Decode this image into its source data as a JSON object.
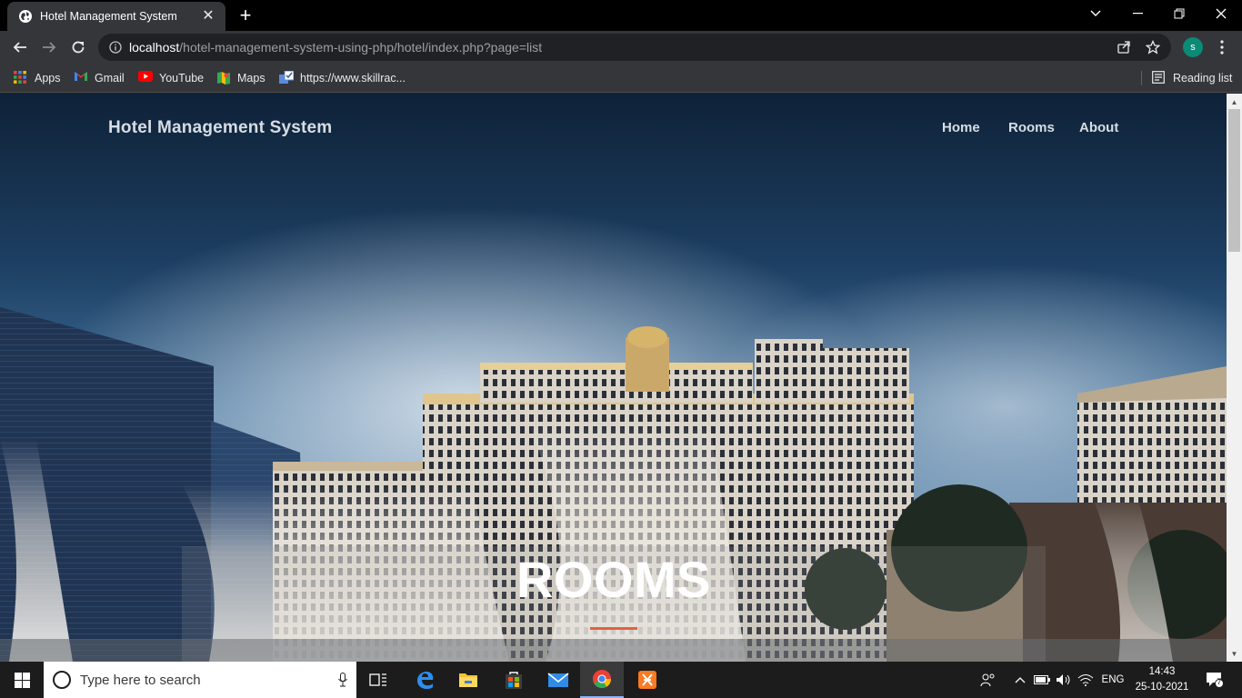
{
  "browser": {
    "tab_title": "Hotel Management System",
    "url_host": "localhost",
    "url_path": "/hotel-management-system-using-php/hotel/index.php?page=list",
    "profile_initial": "s",
    "profile_color": "#0b8a76"
  },
  "bookmarks": {
    "items": [
      {
        "label": "Apps",
        "icon": "apps-grid-icon"
      },
      {
        "label": "Gmail",
        "icon": "gmail-icon"
      },
      {
        "label": "YouTube",
        "icon": "youtube-icon"
      },
      {
        "label": "Maps",
        "icon": "maps-icon"
      },
      {
        "label": "https://www.skillrac...",
        "icon": "skillrack-icon"
      }
    ],
    "reading_list": "Reading list"
  },
  "site": {
    "brand": "Hotel Management System",
    "nav": [
      {
        "label": "Home"
      },
      {
        "label": "Rooms"
      },
      {
        "label": "About"
      }
    ],
    "heading": "ROOMS",
    "accent_color": "#e5603d"
  },
  "taskbar": {
    "search_placeholder": "Type here to search",
    "apps": [
      "task-view-icon",
      "edge-icon",
      "file-explorer-icon",
      "store-icon",
      "mail-icon",
      "chrome-icon",
      "xampp-icon"
    ],
    "language": "ENG",
    "time": "14:43",
    "date": "25-10-2021",
    "notification_count": "7"
  }
}
